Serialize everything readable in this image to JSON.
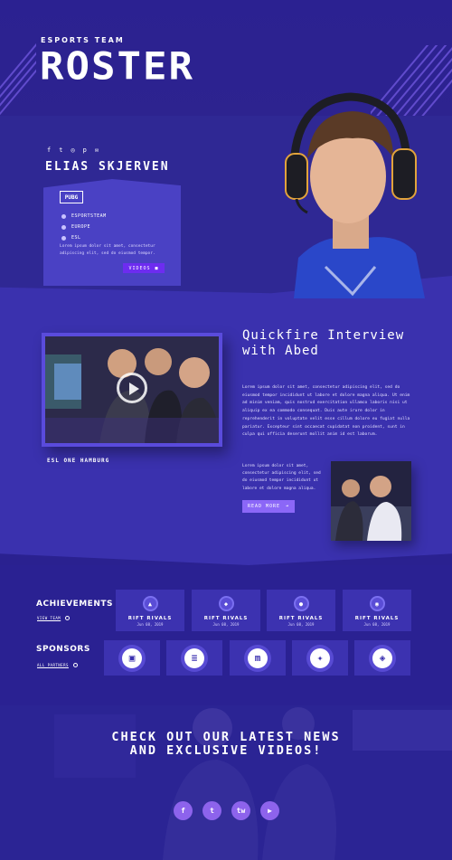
{
  "hero": {
    "eyebrow": "ESPORTS TEAM",
    "title": "ROSTER",
    "social_icons": [
      "f",
      "t",
      "◎",
      "p",
      "✉"
    ],
    "player_name": "ELIAS SKJERVEN",
    "card_logo": "PUBG",
    "meta": [
      {
        "icon": "team-icon",
        "text": "ESPORTSTEAM"
      },
      {
        "icon": "location-icon",
        "text": "EUROPE"
      },
      {
        "icon": "gamepad-icon",
        "text": "ESL"
      }
    ],
    "card_description": "Lorem ipsum dolor sit amet, consectetur adipiscing elit, sed do eiusmod tempor.",
    "videos_button": "VIDEOS"
  },
  "interview": {
    "title": "Quickfire Interview with Abed",
    "body": "Lorem ipsum dolor sit amet, consectetur adipiscing elit, sed do eiusmod tempor incididunt ut labore et dolore magna aliqua. Ut enim ad minim veniam, quis nostrud exercitation ullamco laboris nisi ut aliquip ex ea commodo consequat. Duis aute irure dolor in reprehenderit in voluptate velit esse cillum dolore eu fugiat nulla pariatur. Excepteur sint occaecat cupidatat non proident, sunt in culpa qui officia deserunt mollit anim id est laborum.",
    "video_caption": "ESL ONE HAMBURG",
    "short_text": "Lorem ipsum dolor sit amet, consectetur adipiscing elit, sed do eiusmod tempor incididunt ut labore et dolore magna aliqua.",
    "read_more": "READ MORE"
  },
  "achievements": {
    "heading": "ACHIEVEMENTS",
    "link": "VIEW TEAM",
    "items": [
      {
        "title": "RIFT RIVALS",
        "date": "Jun 08, 2019"
      },
      {
        "title": "RIFT RIVALS",
        "date": "Jun 08, 2019"
      },
      {
        "title": "RIFT RIVALS",
        "date": "Jun 08, 2019"
      },
      {
        "title": "RIFT RIVALS",
        "date": "Jun 08, 2019"
      }
    ]
  },
  "sponsors": {
    "heading": "SPONSORS",
    "link": "ALL PARTNERS",
    "logos": [
      "twitch-logo",
      "stripe-logo",
      "m-logo",
      "pinwheel-logo",
      "knot-logo"
    ]
  },
  "cta": {
    "title": "CHECK OUT OUR LATEST NEWS AND EXCLUSIVE VIDEOS!",
    "social": [
      "f",
      "t",
      "tw",
      "▶"
    ]
  },
  "colors": {
    "background": "#2a2190",
    "accent": "#6d2cf0",
    "button": "#8b67f7",
    "card": "#3c32b0"
  }
}
